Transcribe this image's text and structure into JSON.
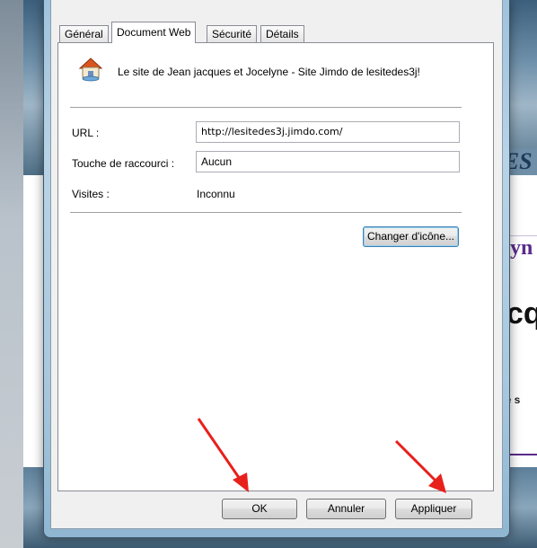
{
  "dialog": {
    "tabs": [
      {
        "label": "Général",
        "active": false
      },
      {
        "label": "Document Web",
        "active": true
      },
      {
        "label": "Sécurité",
        "active": false
      },
      {
        "label": "Détails",
        "active": false
      }
    ],
    "site_title": "Le site de Jean jacques et Jocelyne - Site Jimdo de lesitedes3j!",
    "site_icon": "house-globe-icon",
    "url_label": "URL :",
    "url_value": "http://lesitedes3j.jimdo.com/",
    "shortcut_label": "Touche de raccourci :",
    "shortcut_value": "Aucun",
    "visits_label": "Visites :",
    "visits_value": "Inconnu",
    "change_icon_label": "Changer d'icône...",
    "buttons": {
      "ok": "OK",
      "cancel": "Annuler",
      "apply": "Appliquer"
    },
    "annotation_color": "#e8201c"
  },
  "background": {
    "banner_text": "DES",
    "purple_text": "celyn",
    "big_text": "acq",
    "small_text": "votre s"
  }
}
